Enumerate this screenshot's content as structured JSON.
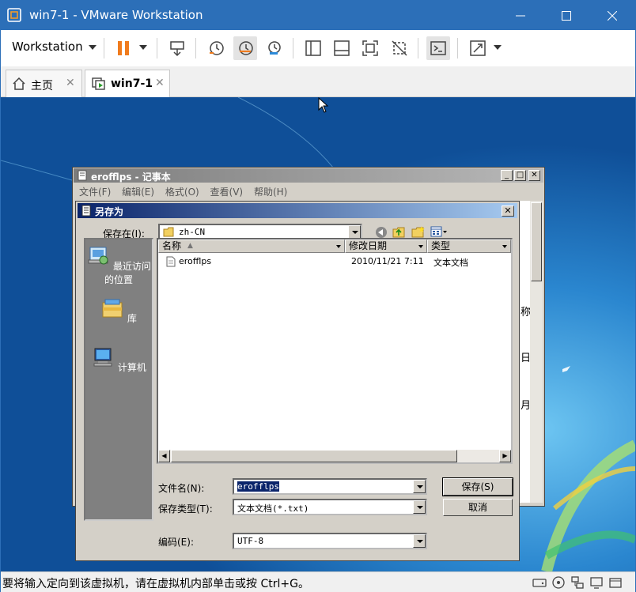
{
  "window": {
    "title": "win7-1 - VMware Workstation"
  },
  "toolbar": {
    "workstation_label": "Workstation"
  },
  "tabs": [
    {
      "label": "主页"
    },
    {
      "label": "win7-1"
    }
  ],
  "notepad": {
    "title": "erofflps - 记事本",
    "menu": [
      "文件(F)",
      "编辑(E)",
      "格式(O)",
      "查看(V)",
      "帮助(H)"
    ],
    "visible_text_fragments": [
      "称",
      "日",
      "月"
    ]
  },
  "save_dialog": {
    "title": "另存为",
    "save_in_label": "保存在(I):",
    "save_in_value": "zh-CN",
    "places": [
      "最近访问的位置",
      "库",
      "计算机"
    ],
    "columns": [
      "名称",
      "修改日期",
      "类型"
    ],
    "files": [
      {
        "name": "erofflps",
        "modified": "2010/11/21 7:11",
        "type": "文本文档"
      }
    ],
    "filename_label": "文件名(N):",
    "filename_value": "erofflps",
    "filetype_label": "保存类型(T):",
    "filetype_value": "文本文档(*.txt)",
    "encoding_label": "编码(E):",
    "encoding_value": "UTF-8",
    "save_button": "保存(S)",
    "cancel_button": "取消"
  },
  "statusbar": {
    "message": "要将输入定向到该虚拟机，请在虚拟机内部单击或按 Ctrl+G。"
  },
  "colors": {
    "titlebar": "#2c6fb8",
    "desktop": "#1a68b4",
    "dialog_title": "#0a246a"
  }
}
